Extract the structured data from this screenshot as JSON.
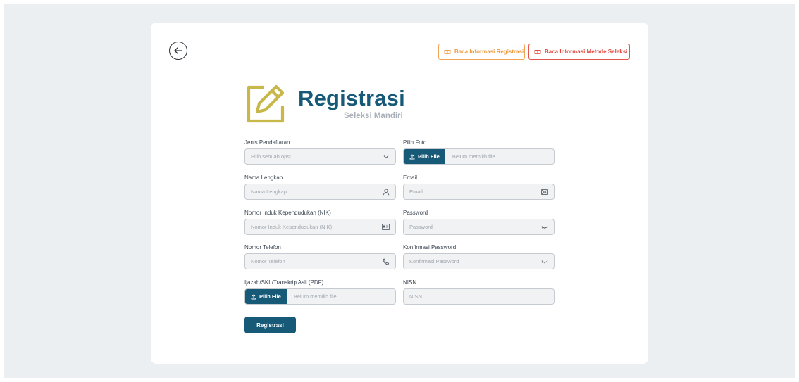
{
  "header": {
    "btn_info_registrasi": "Baca Informasi Registrasi",
    "btn_info_metode": "Baca Informasi Metode Seleksi"
  },
  "logo": {
    "title": "Registrasi",
    "subtitle": "Seleksi Mandiri"
  },
  "form": {
    "jenis": {
      "label": "Jenis Pendaftaran",
      "placeholder": "Pilih sebuah opsi..."
    },
    "foto": {
      "label": "Pilih Foto",
      "button": "Pilih File",
      "status": "Belum memilih file"
    },
    "nama": {
      "label": "Nama Lengkap",
      "placeholder": "Nama Lengkap"
    },
    "email": {
      "label": "Email",
      "placeholder": "Email"
    },
    "nik": {
      "label": "Nomor Induk Kependudukan (NIK)",
      "placeholder": "Nomor Induk Kependudukan (NIK)"
    },
    "password": {
      "label": "Password",
      "placeholder": "Password"
    },
    "telefon": {
      "label": "Nomor Telefon",
      "placeholder": "Nomor Telefon"
    },
    "konfirmasi": {
      "label": "Konfirmasi Password",
      "placeholder": "Konfirmasi Password"
    },
    "ijazah": {
      "label": "Ijazah/SKL/Transkrip Asli (PDF)",
      "button": "Pilih File",
      "status": "Belum memilih file"
    },
    "nisn": {
      "label": "NISN",
      "placeholder": "NISN"
    },
    "submit": "Registrasi"
  },
  "colors": {
    "primary": "#175a78",
    "accent_logo": "#c8b84a",
    "orange": "#f09a3e",
    "red": "#e0473c",
    "page_bg": "#eceff2"
  }
}
